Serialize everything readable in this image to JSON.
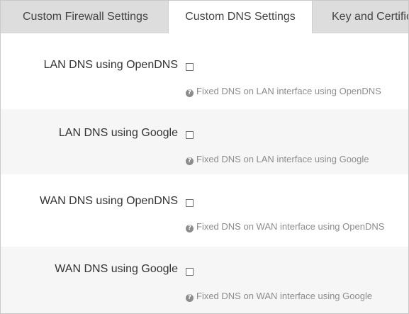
{
  "tabs": [
    {
      "label": "Custom Firewall Settings",
      "active": false
    },
    {
      "label": "Custom DNS Settings",
      "active": true
    },
    {
      "label": "Key and Certific",
      "active": false
    }
  ],
  "settings": [
    {
      "label": "LAN DNS using OpenDNS",
      "checked": false,
      "hint": "Fixed DNS on LAN interface using OpenDNS"
    },
    {
      "label": "LAN DNS using Google",
      "checked": false,
      "hint": "Fixed DNS on LAN interface using Google"
    },
    {
      "label": "WAN DNS using OpenDNS",
      "checked": false,
      "hint": "Fixed DNS on WAN interface using OpenDNS"
    },
    {
      "label": "WAN DNS using Google",
      "checked": false,
      "hint": "Fixed DNS on WAN interface using Google"
    }
  ],
  "icons": {
    "hint_icon": "question-circle-icon"
  }
}
